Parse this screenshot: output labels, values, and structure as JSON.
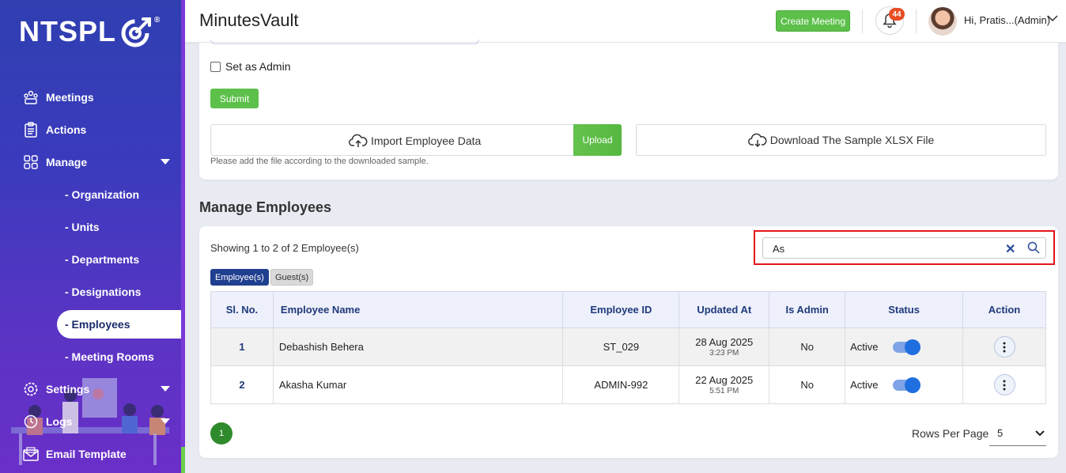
{
  "brand": {
    "logo_text": "NTSPL",
    "reg_mark": "®"
  },
  "sidebar": {
    "items": [
      {
        "label": "Meetings",
        "icon": "meetings-icon"
      },
      {
        "label": "Actions",
        "icon": "clipboard-icon"
      },
      {
        "label": "Manage",
        "icon": "grid-icon"
      },
      {
        "label": "Settings",
        "icon": "gear-icon"
      },
      {
        "label": "Logs",
        "icon": "history-icon"
      },
      {
        "label": "Email Template",
        "icon": "envelope-icon"
      }
    ],
    "sub_items": [
      {
        "label": "- Organization"
      },
      {
        "label": "- Units"
      },
      {
        "label": "- Departments"
      },
      {
        "label": "- Designations"
      },
      {
        "label": "- Employees",
        "active": true
      },
      {
        "label": "- Meeting Rooms"
      }
    ]
  },
  "header": {
    "title": "MinutesVault",
    "create_button": "Create Meeting",
    "notification_count": "44",
    "user_greeting": "Hi, Pratis...(Admin)"
  },
  "form": {
    "set_admin_label": "Set as Admin",
    "submit_label": "Submit",
    "import_label": "Import Employee Data",
    "upload_label": "Upload",
    "download_label": "Download The Sample XLSX File",
    "hint": "Please add the file according to the downloaded sample."
  },
  "section_title": "Manage Employees",
  "list": {
    "showing": "Showing 1 to 2 of 2 Employee(s)",
    "search_value": "As",
    "tabs": [
      {
        "label": "Employee(s)",
        "active": true
      },
      {
        "label": "Guest(s)",
        "active": false
      }
    ],
    "columns": [
      "Sl. No.",
      "Employee Name",
      "Employee ID",
      "Updated At",
      "Is Admin",
      "Status",
      "Action"
    ],
    "rows": [
      {
        "sl": "1",
        "name": "Debashish Behera",
        "emp_id": "ST_029",
        "date": "28 Aug 2025",
        "time": "3:23 PM",
        "is_admin": "No",
        "status": "Active"
      },
      {
        "sl": "2",
        "name": "Akasha Kumar",
        "emp_id": "ADMIN-992",
        "date": "22 Aug 2025",
        "time": "5:51 PM",
        "is_admin": "No",
        "status": "Active"
      }
    ],
    "page": "1",
    "rows_per_page_label": "Rows Per Page",
    "rows_per_page": "5"
  },
  "colors": {
    "sidebar": "#3b3bbd",
    "accent_green": "#5cc04a",
    "primary_blue": "#1f3f8f",
    "highlight_red": "#e3141b"
  }
}
